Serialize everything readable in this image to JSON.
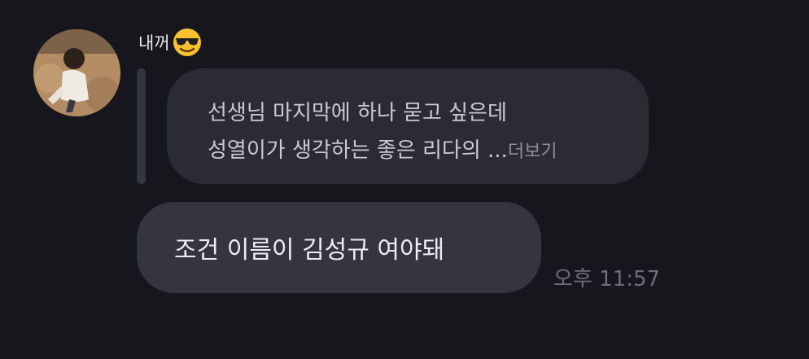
{
  "chat": {
    "sender_name": "내꺼",
    "sender_emoji_icon": "sunglasses-face-icon",
    "avatar_icon": "profile-photo-icon",
    "reply_preview": {
      "line1": "선생님 마지막에 하나 묻고 싶은데",
      "line2": "성열이가 생각하는 좋은 리다의 ...",
      "more_label": "더보기"
    },
    "message_text": "조건 이름이 김성규 여야돼",
    "timestamp": "오후 11:57"
  },
  "colors": {
    "background": "#16161c",
    "quoted_bubble": "#2b2c33",
    "message_bubble": "#34353d",
    "emoji_yellow": "#f7c22e"
  }
}
